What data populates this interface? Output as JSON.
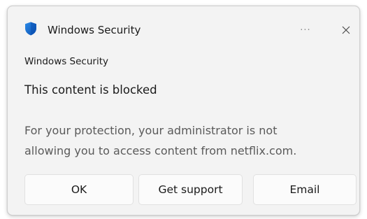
{
  "window": {
    "title": "Windows Security",
    "app_icon": "shield-icon",
    "more_icon": "more-options-icon",
    "more_glyph": "···",
    "close_icon": "close-icon",
    "accent_color": "#0a63c7"
  },
  "dialog": {
    "source_label": "Windows Security",
    "heading": "This content is blocked",
    "message_line1": "For your protection, your administrator is not",
    "message_line2": "allowing you to access content from netflix.com."
  },
  "buttons": {
    "ok": "OK",
    "support": "Get support",
    "email": "Email"
  }
}
